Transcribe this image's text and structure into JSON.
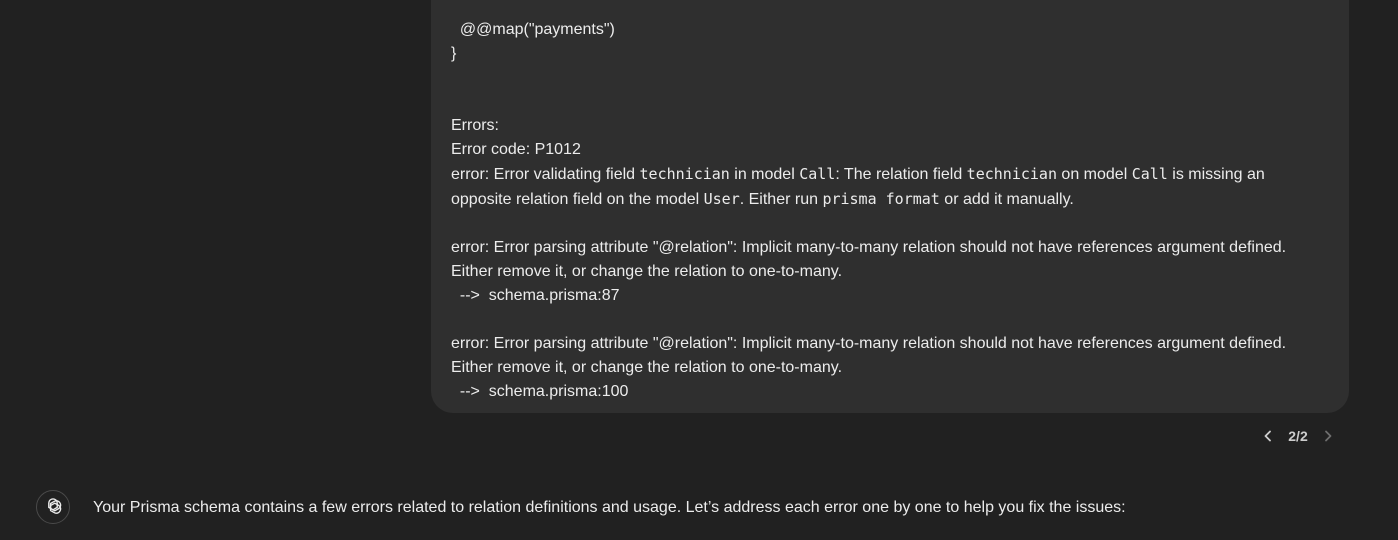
{
  "user_message": {
    "lines": {
      "map_line": "  @@map(\"payments\")",
      "brace": "}",
      "errors_heading": "Errors:",
      "error_code": "Error code: P1012",
      "e1_a": "error: Error validating field ",
      "e1_field": "technician",
      "e1_b": " in model ",
      "e1_model": "Call",
      "e1_c": ": The relation field ",
      "e1_field2": "technician",
      "e1_d": " on model ",
      "e1_model2": "Call",
      "e1_e": " is missing an",
      "e1l2_a": "opposite relation field on the model ",
      "e1l2_user": "User",
      "e1l2_b": ". Either run ",
      "e1l2_cmd": "prisma format",
      "e1l2_c": " or add it manually.",
      "e2_l1": "error: Error parsing attribute \"@relation\": Implicit many-to-many relation should not have references argument defined.",
      "e2_l2": "Either remove it, or change the relation to one-to-many.",
      "e2_l3": "  -->  schema.prisma:87",
      "e3_l1": "error: Error parsing attribute \"@relation\": Implicit many-to-many relation should not have references argument defined.",
      "e3_l2": "Either remove it, or change the relation to one-to-many.",
      "e3_l3": "  -->  schema.prisma:100"
    }
  },
  "pagination": {
    "label": "2/2",
    "prev_icon": "chevron-left-icon",
    "next_icon": "chevron-right-icon"
  },
  "assistant_message": {
    "avatar_icon": "openai-logo-icon",
    "text": "Your Prisma schema contains a few errors related to relation definitions and usage. Let’s address each error one by one to help you fix the issues:"
  }
}
